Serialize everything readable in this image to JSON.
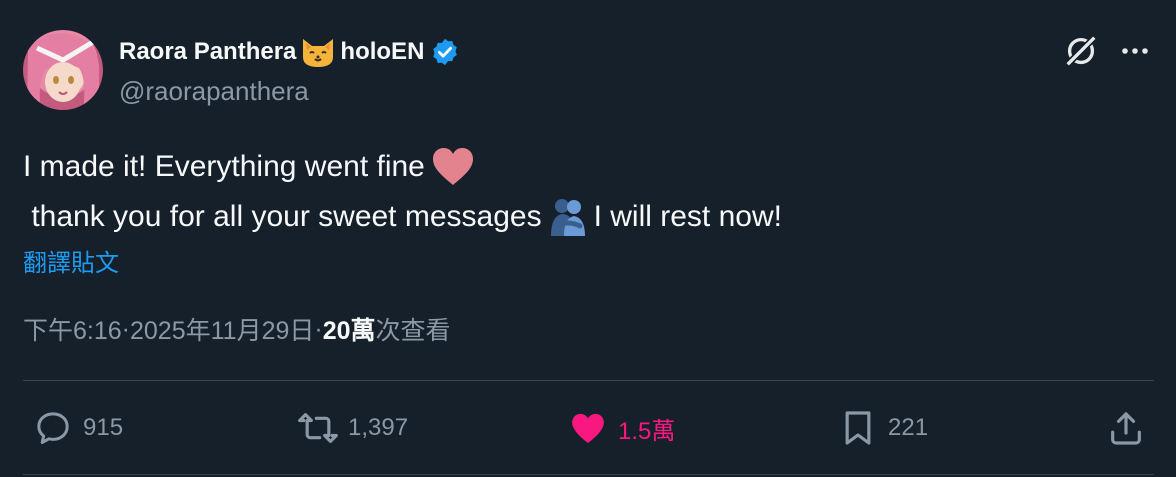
{
  "author": {
    "display_name": "Raora Panthera",
    "name_suffix": "holoEN",
    "handle": "@raorapanthera",
    "verified": true,
    "emoji_icon": "cat-face-icon"
  },
  "header_icons": [
    "grok-icon",
    "more-icon"
  ],
  "tweet": {
    "line1": "I made it! Everything went fine",
    "line2_start": " thank you for all your sweet messages",
    "line2_end": "I will rest now!",
    "emojis": [
      "heart-icon",
      "hug-icon"
    ]
  },
  "translate_label": "翻譯貼文",
  "meta": {
    "time": "下午6:16",
    "separator1": " · ",
    "date": "2025年11月29日",
    "separator2": " · ",
    "views_count": "20萬",
    "views_label": " 次查看"
  },
  "actions": {
    "reply_count": "915",
    "repost_count": "1,397",
    "like_count": "1.5萬",
    "bookmark_count": "221"
  },
  "colors": {
    "background": "#15202b",
    "accent": "#1d9bf0",
    "like": "#f91880",
    "muted": "#8b98a5"
  }
}
